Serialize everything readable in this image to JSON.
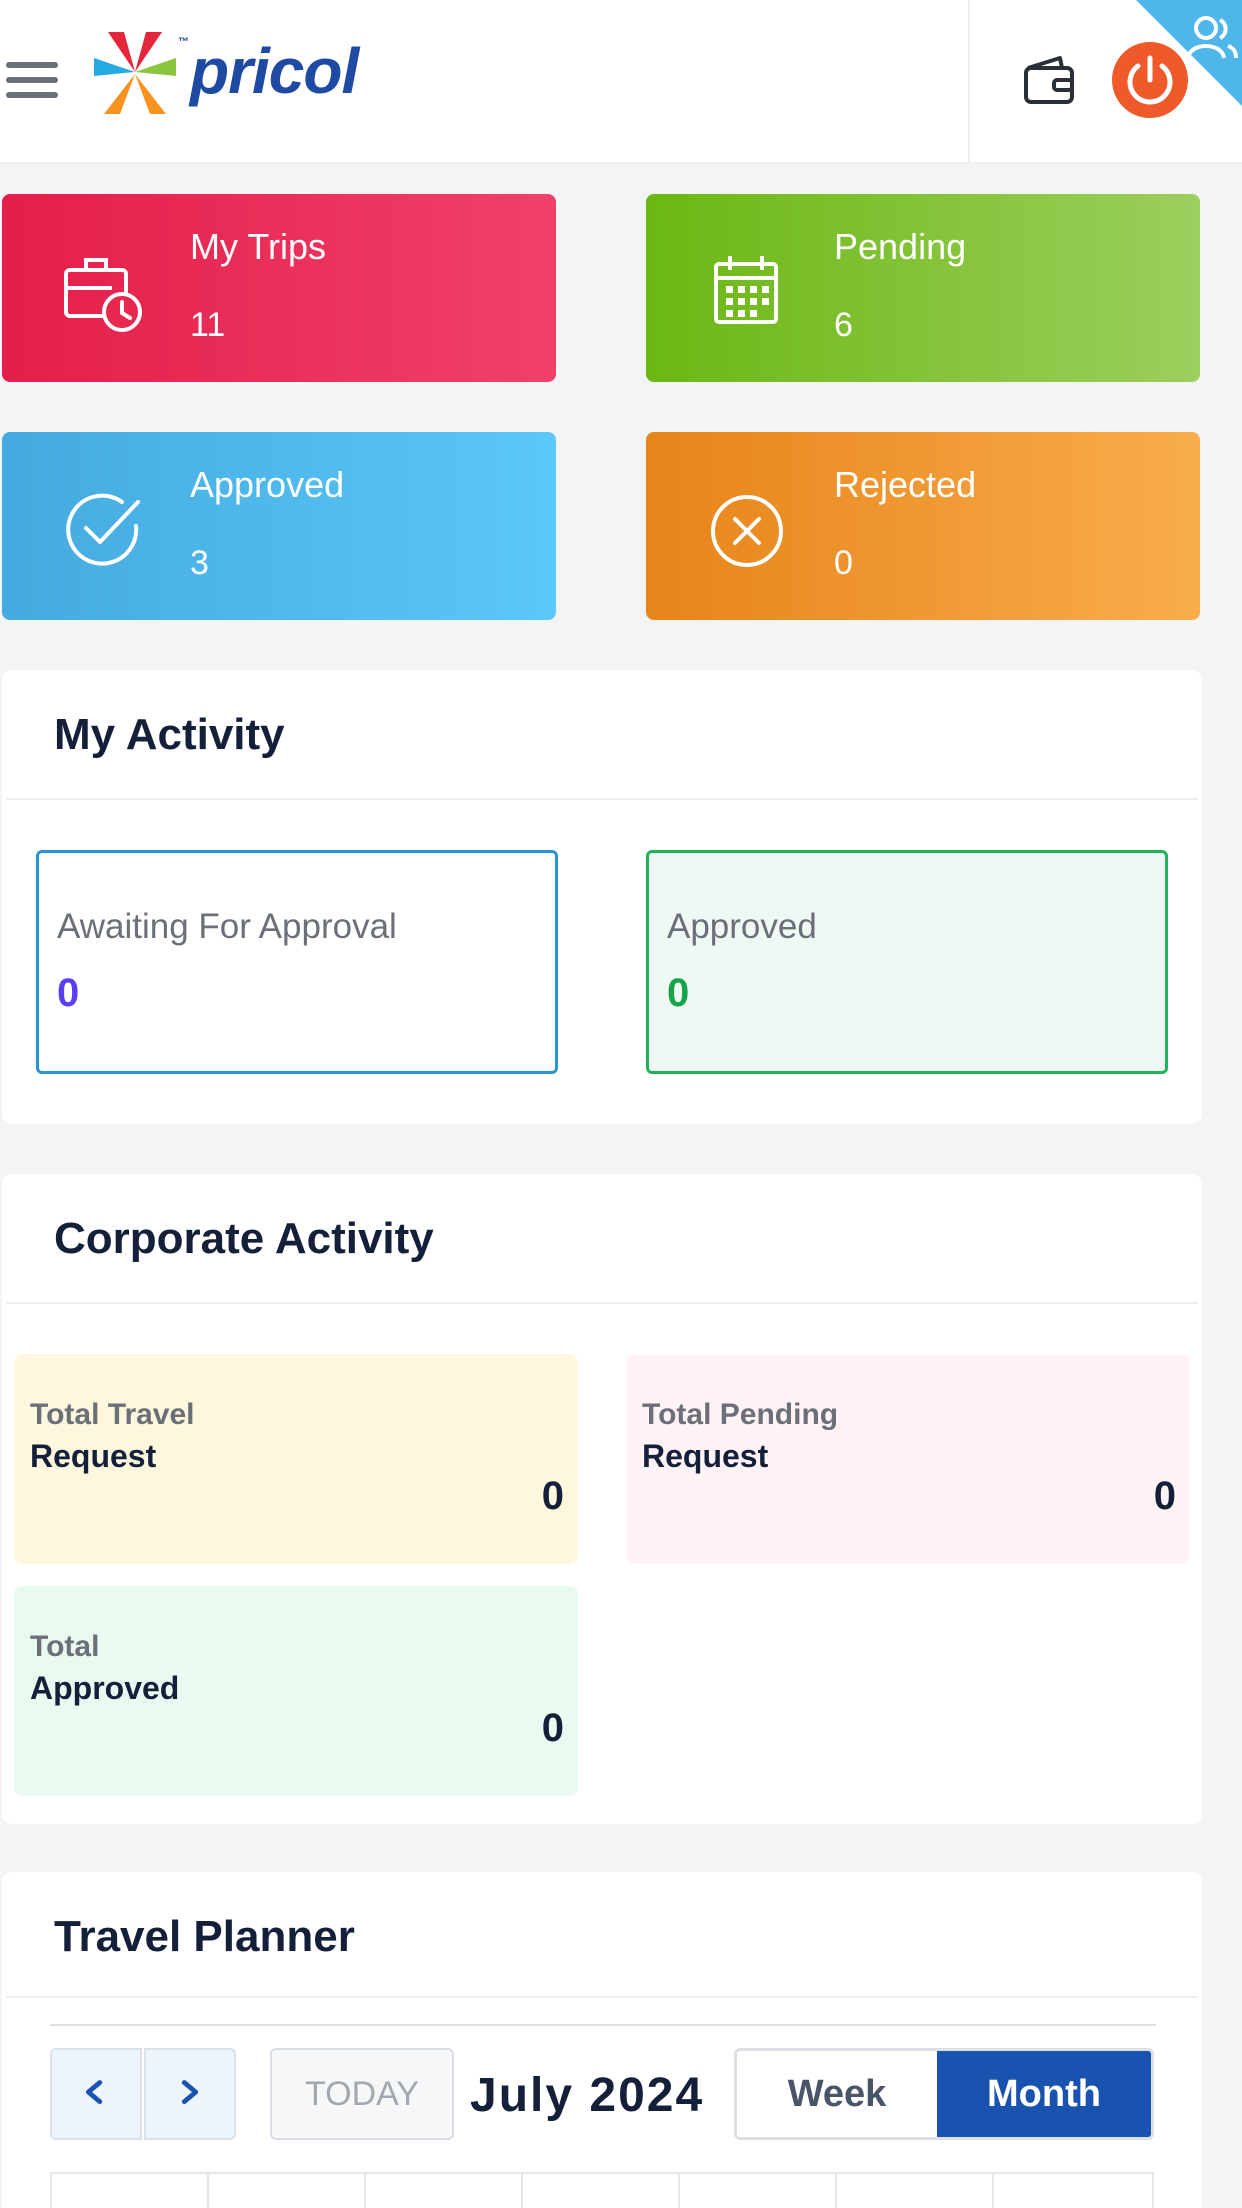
{
  "header": {
    "brand": "pricol",
    "brand_tm": "™",
    "colors": {
      "brand_blue": "#1e4aa3",
      "power": "#f0592a",
      "corner": "#4fb6ea"
    }
  },
  "stats": [
    {
      "label": "My Trips",
      "value": "11",
      "icon": "briefcase-clock-icon",
      "color": "#e41e4a"
    },
    {
      "label": "Pending",
      "value": "6",
      "icon": "calendar-icon",
      "color": "#6bb713"
    },
    {
      "label": "Approved",
      "value": "3",
      "icon": "check-circle-icon",
      "color": "#45aadf"
    },
    {
      "label": "Rejected",
      "value": "0",
      "icon": "x-circle-icon",
      "color": "#e7841a"
    }
  ],
  "my_activity": {
    "title": "My Activity",
    "awaiting": {
      "label": "Awaiting For Approval",
      "value": "0",
      "color": "#5b3df5"
    },
    "approved": {
      "label": "Approved",
      "value": "0",
      "color": "#17a34a"
    }
  },
  "corporate_activity": {
    "title": "Corporate Activity",
    "cards": [
      {
        "line1": "Total Travel",
        "line2": "Request",
        "value": "0",
        "bg": "#fdf7dd"
      },
      {
        "line1": "Total Pending",
        "line2": "Request",
        "value": "0",
        "bg": "#fff3f6"
      },
      {
        "line1": "Total",
        "line2": "Approved",
        "value": "0",
        "bg": "#e9fbf1"
      }
    ]
  },
  "travel_planner": {
    "title": "Travel Planner",
    "today_label": "TODAY",
    "month_label": "July 2024",
    "views": [
      "Week",
      "Month"
    ],
    "active_view": "Month",
    "active_color": "#1a52b0"
  }
}
